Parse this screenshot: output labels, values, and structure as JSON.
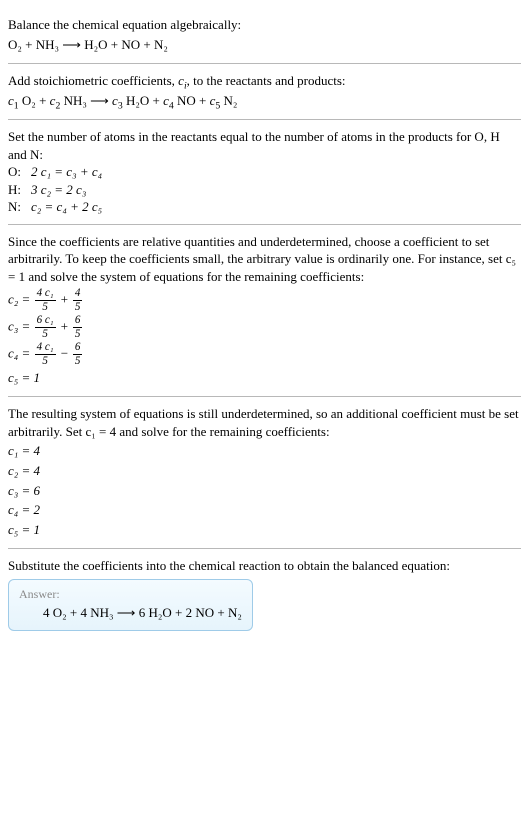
{
  "s1": {
    "l1": "Balance the chemical equation algebraically:",
    "eq": "O₂ + NH₃  ⟶  H₂O + NO + N₂"
  },
  "s2": {
    "l1_a": "Add stoichiometric coefficients, ",
    "l1_b": "c",
    "l1_c": "i",
    "l1_d": ", to the reactants and products:",
    "eq_c1": "c",
    "eq_c1s": "1",
    "eq_t1": " O₂ + ",
    "eq_c2": "c",
    "eq_c2s": "2",
    "eq_t2": " NH₃  ⟶  ",
    "eq_c3": "c",
    "eq_c3s": "3",
    "eq_t3": " H₂O + ",
    "eq_c4": "c",
    "eq_c4s": "4",
    "eq_t4": " NO + ",
    "eq_c5": "c",
    "eq_c5s": "5",
    "eq_t5": " N₂"
  },
  "s3": {
    "l1": "Set the number of atoms in the reactants equal to the number of atoms in the products for O, H and N:",
    "rowO_l": "O:  ",
    "rowO_r": "2 c₁ = c₃ + c₄",
    "rowH_l": "H:  ",
    "rowH_r": "3 c₂ = 2 c₃",
    "rowN_l": "N:  ",
    "rowN_r": "c₂ = c₄ + 2 c₅"
  },
  "s4": {
    "l1": "Since the coefficients are relative quantities and underdetermined, choose a coefficient to set arbitrarily. To keep the coefficients small, the arbitrary value is ordinarily one. For instance, set c₅ = 1 and solve the system of equations for the remaining coefficients:",
    "c2_l": "c₂ = ",
    "c2_f1n": "4 c₁",
    "c2_f1d": "5",
    "c2_mid": " + ",
    "c2_f2n": "4",
    "c2_f2d": "5",
    "c3_l": "c₃ = ",
    "c3_f1n": "6 c₁",
    "c3_f1d": "5",
    "c3_mid": " + ",
    "c3_f2n": "6",
    "c3_f2d": "5",
    "c4_l": "c₄ = ",
    "c4_f1n": "4 c₁",
    "c4_f1d": "5",
    "c4_mid": " − ",
    "c4_f2n": "6",
    "c4_f2d": "5",
    "c5": "c₅ = 1"
  },
  "s5": {
    "l1": "The resulting system of equations is still underdetermined, so an additional coefficient must be set arbitrarily. Set c₁ = 4 and solve for the remaining coefficients:",
    "r1": "c₁ = 4",
    "r2": "c₂ = 4",
    "r3": "c₃ = 6",
    "r4": "c₄ = 2",
    "r5": "c₅ = 1"
  },
  "s6": {
    "l1": "Substitute the coefficients into the chemical reaction to obtain the balanced equation:",
    "answer_label": "Answer:",
    "answer_eq": "4 O₂ + 4 NH₃  ⟶  6 H₂O + 2 NO + N₂"
  }
}
